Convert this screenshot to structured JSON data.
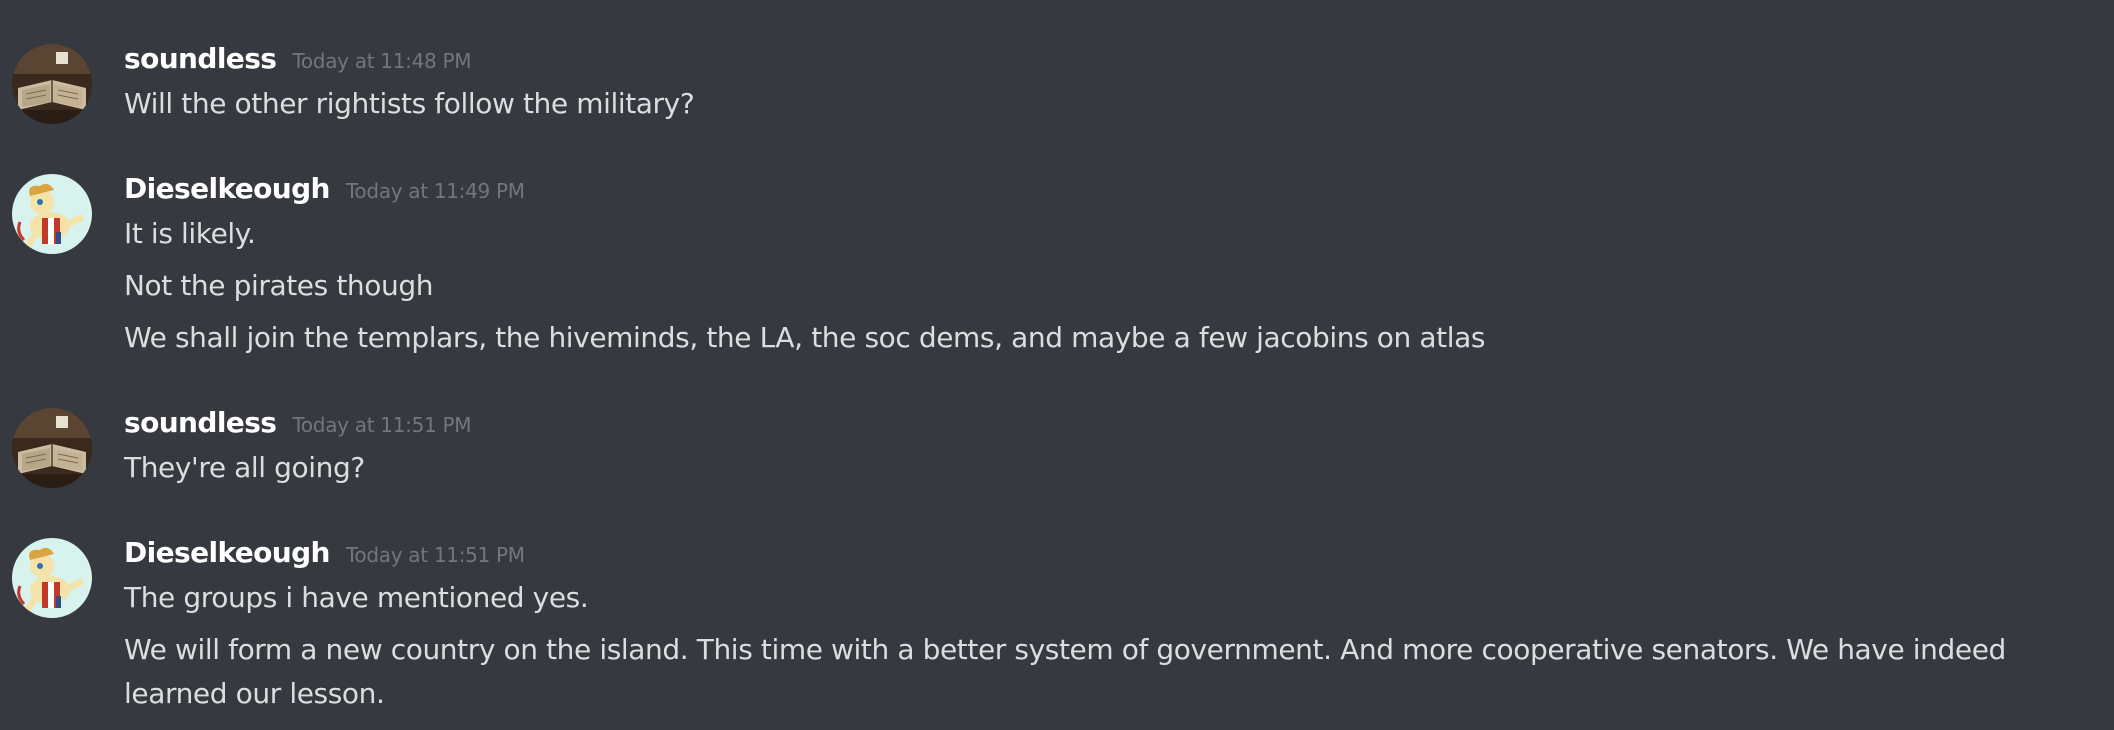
{
  "messages": [
    {
      "author": "soundless",
      "timestamp": "Today at 11:48 PM",
      "avatar": "book-photo-avatar",
      "lines": [
        "Will the other rightists follow the military?"
      ]
    },
    {
      "author": "Dieselkeough",
      "timestamp": "Today at 11:49 PM",
      "avatar": "pony-avatar",
      "lines": [
        "It is likely.",
        "Not the pirates though",
        "We shall join the templars, the hiveminds, the LA, the soc dems, and maybe a few jacobins on atlas"
      ]
    },
    {
      "author": "soundless",
      "timestamp": "Today at 11:51 PM",
      "avatar": "book-photo-avatar",
      "lines": [
        "They're all going?"
      ]
    },
    {
      "author": "Dieselkeough",
      "timestamp": "Today at 11:51 PM",
      "avatar": "pony-avatar",
      "lines": [
        "The groups i have mentioned yes.",
        "We will form a new country on the island. This time with a better system of government. And more cooperative senators. We have indeed learned our lesson."
      ]
    }
  ],
  "colors": {
    "background": "#36393f",
    "username": "#ffffff",
    "timestamp": "#72767d",
    "message_text": "#dcddde"
  }
}
